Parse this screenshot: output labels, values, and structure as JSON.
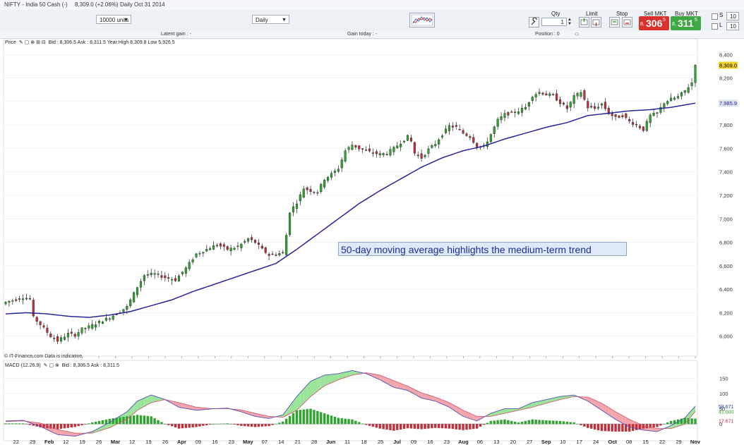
{
  "title_bar": {
    "instrument": "NIFTY - India 50 Cash (-)",
    "last_change": "8,309.0 (+2.06%)",
    "period_date": "Daily  Oct 31 2014"
  },
  "toolbar": {
    "units": "10000 units",
    "interval": "Daily"
  },
  "trade_panel": {
    "qty_label": "Qty",
    "qty_value": "1",
    "limit_label": "Limit",
    "stop_label": "Stop",
    "sell_label": "Sell MKT",
    "buy_label": "Buy MKT",
    "sell_prefix": "8,",
    "sell_big": "306",
    "sell_sup": "5",
    "buy_prefix": "8,",
    "buy_big": "311",
    "buy_sup": "5",
    "s_label": "S",
    "l_label": "L",
    "s_value": "10",
    "l_value": "10"
  },
  "stats_bar": {
    "latent_gain": "Latent gain : -",
    "gain_today": "Gain today : -",
    "position": "Position : 0"
  },
  "price_legend": "Bid : 8,306.5  Ask : 8,311.5  Year:High 8,309.8  Low 5,926.5",
  "price_label": "Price",
  "macd_label": "MACD (12.26.9)",
  "macd_legend": "Bid : 8,306.5  Ask : 8,311.5",
  "credit": "© IT-Finance.com  Data is indicative",
  "annotation": "50-day moving average highlights the medium-term trend",
  "colors": {
    "up_candle": "#2fa52f",
    "down_candle": "#c0303a",
    "moving_average": "#27249a",
    "macd_line": "#5650b8",
    "signal_line": "#d06070",
    "current_price_tag": "#f2d32b",
    "ma_tag": "#dfe3f0"
  },
  "chart_data": [
    {
      "type": "candlestick",
      "x_tick_labels": [
        "22",
        "29",
        "Feb",
        "12",
        "19",
        "26",
        "Mar",
        "12",
        "19",
        "26",
        "Apr",
        "09",
        "16",
        "23",
        "May",
        "07",
        "14",
        "21",
        "28",
        "Jun",
        "11",
        "18",
        "25",
        "Jul",
        "09",
        "16",
        "23",
        "Aug",
        "06",
        "13",
        "20",
        "27",
        "Sep",
        "10",
        "17",
        "24",
        "Oct",
        "08",
        "15",
        "22",
        "29",
        "Nov"
      ],
      "y_ticks": [
        6000,
        6200,
        6400,
        6600,
        6800,
        7000,
        7200,
        7400,
        7600,
        7800,
        8000,
        8200,
        8400
      ],
      "y_tick_labels": [
        "6,000",
        "6,200",
        "6,400",
        "6,600",
        "6,800",
        "7,000",
        "7,200",
        "7,400",
        "7,600",
        "7,800",
        "8,000",
        "8,200",
        "8,400"
      ],
      "ylim": [
        5830,
        8480
      ],
      "current_price_label": "8,309.0",
      "current_price": 8309,
      "ma_label": "7,985.9",
      "ma_value": 7985.9,
      "close_anchors": [
        [
          0,
          6290
        ],
        [
          5,
          6330
        ],
        [
          7,
          6320
        ],
        [
          8,
          6160
        ],
        [
          10,
          6100
        ],
        [
          13,
          6000
        ],
        [
          15,
          5960
        ],
        [
          18,
          6020
        ],
        [
          20,
          6010
        ],
        [
          22,
          6060
        ],
        [
          24,
          6080
        ],
        [
          27,
          6120
        ],
        [
          30,
          6160
        ],
        [
          33,
          6210
        ],
        [
          35,
          6250
        ],
        [
          38,
          6420
        ],
        [
          40,
          6520
        ],
        [
          43,
          6530
        ],
        [
          46,
          6500
        ],
        [
          49,
          6480
        ],
        [
          52,
          6580
        ],
        [
          55,
          6700
        ],
        [
          58,
          6740
        ],
        [
          61,
          6780
        ],
        [
          64,
          6740
        ],
        [
          67,
          6760
        ],
        [
          70,
          6830
        ],
        [
          72,
          6800
        ],
        [
          74,
          6740
        ],
        [
          76,
          6690
        ],
        [
          78,
          6700
        ],
        [
          80,
          6710
        ],
        [
          81,
          6860
        ],
        [
          82,
          7060
        ],
        [
          84,
          7140
        ],
        [
          86,
          7260
        ],
        [
          88,
          7240
        ],
        [
          90,
          7230
        ],
        [
          92,
          7340
        ],
        [
          94,
          7380
        ],
        [
          96,
          7430
        ],
        [
          98,
          7580
        ],
        [
          100,
          7630
        ],
        [
          102,
          7600
        ],
        [
          104,
          7580
        ],
        [
          106,
          7560
        ],
        [
          108,
          7550
        ],
        [
          110,
          7560
        ],
        [
          112,
          7600
        ],
        [
          114,
          7650
        ],
        [
          116,
          7700
        ],
        [
          117,
          7660
        ],
        [
          118,
          7560
        ],
        [
          120,
          7520
        ],
        [
          122,
          7590
        ],
        [
          124,
          7640
        ],
        [
          126,
          7720
        ],
        [
          128,
          7790
        ],
        [
          130,
          7780
        ],
        [
          132,
          7730
        ],
        [
          134,
          7700
        ],
        [
          136,
          7620
        ],
        [
          138,
          7610
        ],
        [
          140,
          7720
        ],
        [
          142,
          7840
        ],
        [
          144,
          7890
        ],
        [
          146,
          7900
        ],
        [
          148,
          7920
        ],
        [
          150,
          7950
        ],
        [
          152,
          8050
        ],
        [
          154,
          8080
        ],
        [
          156,
          8060
        ],
        [
          158,
          8050
        ],
        [
          160,
          7990
        ],
        [
          162,
          7940
        ],
        [
          164,
          8040
        ],
        [
          166,
          8080
        ],
        [
          168,
          7950
        ],
        [
          170,
          7940
        ],
        [
          172,
          7980
        ],
        [
          174,
          7900
        ],
        [
          176,
          7860
        ],
        [
          178,
          7880
        ],
        [
          180,
          7830
        ],
        [
          182,
          7800
        ],
        [
          184,
          7760
        ],
        [
          186,
          7880
        ],
        [
          188,
          7900
        ],
        [
          190,
          7990
        ],
        [
          192,
          8020
        ],
        [
          194,
          8040
        ],
        [
          196,
          8090
        ],
        [
          198,
          8160
        ],
        [
          199,
          8309
        ]
      ],
      "moving_average_anchors": [
        [
          0,
          6190
        ],
        [
          6,
          6200
        ],
        [
          12,
          6190
        ],
        [
          18,
          6170
        ],
        [
          24,
          6160
        ],
        [
          30,
          6180
        ],
        [
          36,
          6210
        ],
        [
          42,
          6260
        ],
        [
          48,
          6310
        ],
        [
          54,
          6380
        ],
        [
          60,
          6440
        ],
        [
          66,
          6500
        ],
        [
          72,
          6560
        ],
        [
          78,
          6620
        ],
        [
          84,
          6740
        ],
        [
          90,
          6870
        ],
        [
          96,
          7000
        ],
        [
          102,
          7130
        ],
        [
          108,
          7240
        ],
        [
          114,
          7340
        ],
        [
          120,
          7440
        ],
        [
          126,
          7520
        ],
        [
          132,
          7580
        ],
        [
          138,
          7620
        ],
        [
          144,
          7680
        ],
        [
          150,
          7730
        ],
        [
          156,
          7780
        ],
        [
          162,
          7820
        ],
        [
          168,
          7880
        ],
        [
          174,
          7900
        ],
        [
          180,
          7920
        ],
        [
          186,
          7930
        ],
        [
          192,
          7950
        ],
        [
          199,
          7986
        ]
      ]
    },
    {
      "type": "bar",
      "y_ticks": [
        0,
        50,
        100,
        150
      ],
      "y_tick_labels": [
        "0",
        "50",
        "100",
        "150"
      ],
      "ylim": [
        -55,
        190
      ],
      "macd_value_label": "58.671",
      "signal_value_label": "41.000",
      "histogram_value_label": "17.671",
      "macd_value": 58.671,
      "signal_value": 41.0,
      "histogram_value": 17.671,
      "macd_anchors": [
        [
          0,
          10
        ],
        [
          5,
          12
        ],
        [
          10,
          -8
        ],
        [
          15,
          -35
        ],
        [
          20,
          -40
        ],
        [
          25,
          -25
        ],
        [
          30,
          5
        ],
        [
          35,
          40
        ],
        [
          38,
          75
        ],
        [
          42,
          95
        ],
        [
          46,
          80
        ],
        [
          50,
          55
        ],
        [
          55,
          45
        ],
        [
          60,
          50
        ],
        [
          64,
          52
        ],
        [
          68,
          40
        ],
        [
          72,
          25
        ],
        [
          76,
          18
        ],
        [
          80,
          30
        ],
        [
          84,
          90
        ],
        [
          88,
          140
        ],
        [
          92,
          160
        ],
        [
          96,
          165
        ],
        [
          100,
          175
        ],
        [
          104,
          165
        ],
        [
          108,
          145
        ],
        [
          112,
          120
        ],
        [
          116,
          110
        ],
        [
          120,
          85
        ],
        [
          124,
          75
        ],
        [
          128,
          55
        ],
        [
          132,
          25
        ],
        [
          136,
          10
        ],
        [
          140,
          35
        ],
        [
          144,
          50
        ],
        [
          148,
          50
        ],
        [
          152,
          70
        ],
        [
          156,
          80
        ],
        [
          160,
          90
        ],
        [
          164,
          95
        ],
        [
          168,
          75
        ],
        [
          172,
          45
        ],
        [
          176,
          15
        ],
        [
          180,
          -10
        ],
        [
          184,
          -20
        ],
        [
          188,
          -25
        ],
        [
          192,
          -5
        ],
        [
          196,
          20
        ],
        [
          199,
          58.7
        ]
      ],
      "signal_anchors": [
        [
          0,
          8
        ],
        [
          5,
          10
        ],
        [
          10,
          3
        ],
        [
          15,
          -18
        ],
        [
          20,
          -30
        ],
        [
          25,
          -30
        ],
        [
          30,
          -12
        ],
        [
          35,
          15
        ],
        [
          38,
          45
        ],
        [
          42,
          70
        ],
        [
          46,
          80
        ],
        [
          50,
          70
        ],
        [
          55,
          55
        ],
        [
          60,
          50
        ],
        [
          64,
          50
        ],
        [
          68,
          46
        ],
        [
          72,
          35
        ],
        [
          76,
          25
        ],
        [
          80,
          22
        ],
        [
          84,
          45
        ],
        [
          88,
          90
        ],
        [
          92,
          125
        ],
        [
          96,
          145
        ],
        [
          100,
          160
        ],
        [
          104,
          168
        ],
        [
          108,
          160
        ],
        [
          112,
          142
        ],
        [
          116,
          124
        ],
        [
          120,
          102
        ],
        [
          124,
          88
        ],
        [
          128,
          70
        ],
        [
          132,
          45
        ],
        [
          136,
          25
        ],
        [
          140,
          25
        ],
        [
          144,
          35
        ],
        [
          148,
          45
        ],
        [
          152,
          55
        ],
        [
          156,
          68
        ],
        [
          160,
          80
        ],
        [
          164,
          90
        ],
        [
          168,
          88
        ],
        [
          172,
          68
        ],
        [
          176,
          40
        ],
        [
          180,
          15
        ],
        [
          184,
          -5
        ],
        [
          188,
          -15
        ],
        [
          192,
          -15
        ],
        [
          196,
          0
        ],
        [
          199,
          41
        ]
      ]
    }
  ]
}
